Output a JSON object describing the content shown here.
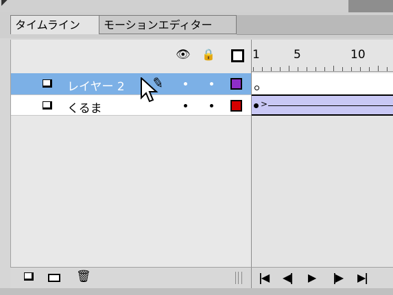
{
  "tabs": [
    {
      "label": "タイムライン",
      "active": true
    },
    {
      "label": "モーションエディター",
      "active": false
    }
  ],
  "header": {
    "frame_numbers": [
      "1",
      "5",
      "10"
    ],
    "icons": [
      "eye-icon",
      "lock-icon",
      "outline-icon"
    ]
  },
  "layers": [
    {
      "name": "レイヤー 2",
      "selected": true,
      "color": "#8e2ec8",
      "editing": true
    },
    {
      "name": "くるま",
      "selected": false,
      "color": "#d40000",
      "editing": false
    }
  ],
  "timeline": {
    "row1": {
      "keyframe": "empty"
    },
    "row2": {
      "keyframe": "filled",
      "tween": "motion",
      "tween_color": "#c9c8f5"
    }
  },
  "colors": {
    "selection": "#7cb0e6",
    "panel_bg": "#e8e8e8"
  },
  "bottom_tools": [
    "new-layer-icon",
    "new-folder-icon",
    "trash-icon"
  ],
  "playback_controls": [
    "go-to-first-frame",
    "step-back",
    "play",
    "step-forward",
    "go-to-last-frame"
  ]
}
